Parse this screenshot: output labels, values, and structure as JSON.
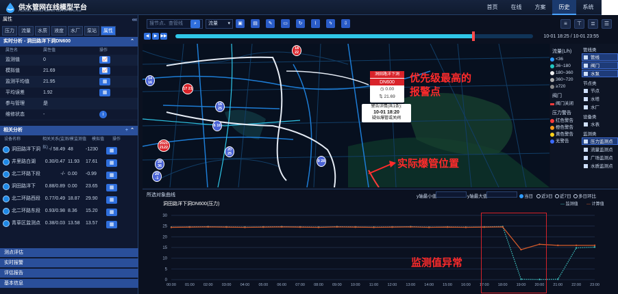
{
  "header": {
    "title": "供水管网在线模型平台",
    "subtitle": "FUZHOU ONLINE WATER SUPPLY SYSTEM",
    "nav": [
      "首页",
      "在线",
      "方案",
      "历史",
      "系统"
    ],
    "active_nav": "历史"
  },
  "left": {
    "panel_title": "属性",
    "tabs": [
      "压力",
      "流量",
      "水质",
      "液度",
      "水厂",
      "泵站",
      "属性"
    ],
    "active_tab": "属性",
    "realtime": {
      "title": "实时分析 - 洞田路洋下洞DN600",
      "columns": [
        "属性名",
        "属性值",
        "操作"
      ],
      "rows": [
        {
          "name": "监测值",
          "value": "0",
          "op": "📈"
        },
        {
          "name": "模拟值",
          "value": "21.69",
          "op": "📈"
        },
        {
          "name": "监测平均值",
          "value": "21.95",
          "op": "▦"
        },
        {
          "name": "平均误差",
          "value": "1.92",
          "op": "▦"
        },
        {
          "name": "参与管理",
          "value": "是",
          "op": ""
        },
        {
          "name": "维修状态",
          "value": "-",
          "op": "i"
        }
      ]
    },
    "correlation": {
      "title": "相关分析",
      "columns": [
        "设备名称",
        "相关关系(监测/模拟)",
        "监测值",
        "模拟值",
        "操作"
      ],
      "rows": [
        {
          "name": "洞田路洋下洞",
          "a": "-/ 58.49",
          "b": "48",
          "c": "-1230"
        },
        {
          "name": "井里路白湖",
          "a": "0.30/0.47",
          "b": "11.93",
          "c": "17.61"
        },
        {
          "name": "北二环路下段",
          "a": "-/-",
          "b": "0.00",
          "c": "-0.99"
        },
        {
          "name": "洞田路洋下",
          "a": "0.88/0.89",
          "b": "0.00",
          "c": "23.65"
        },
        {
          "name": "北二环路西段",
          "a": "0.77/0.49",
          "b": "18.87",
          "c": "29.90"
        },
        {
          "name": "北二环路东段",
          "a": "0.93/0.98",
          "b": "8.36",
          "c": "15.20"
        },
        {
          "name": "青草区监测点",
          "a": "0.38/0.03",
          "b": "13.58",
          "c": "13.57"
        }
      ]
    },
    "bottom_items": [
      "测点评估",
      "实时报警",
      "评估报告",
      "基本信息"
    ]
  },
  "toolbar": {
    "search_placeholder": "搜节点、查管线",
    "select": "流量"
  },
  "timeline": {
    "range": "10-01 18:25 / 10-01 23:55",
    "progress": 0.83
  },
  "map": {
    "popup": {
      "head": "洞田路洋下洞",
      "name": "DN600",
      "v1": "0.00",
      "v2": "21.69"
    },
    "alarm": {
      "l1": "警告详情(共1条):",
      "l2": "10-01 18:20",
      "l3": "疑似爆管或关阀"
    },
    "markers": [
      {
        "t": "18\n22"
      },
      {
        "t": "17\n21"
      },
      {
        "t": "14\n16"
      },
      {
        "t": "16\n25"
      },
      {
        "t": "6\n16"
      },
      {
        "t": "20\n25"
      },
      {
        "t": "9\n28"
      },
      {
        "t": "2021\n2122"
      },
      {
        "t": "28\n36"
      },
      {
        "t": "20\n-1"
      }
    ]
  },
  "legend": {
    "flow_title": "流量(L/h)",
    "flow": [
      {
        "label": "<36",
        "color": "#2f9bff"
      },
      {
        "label": "36~180",
        "color": "#22c7c0"
      },
      {
        "label": "180~360",
        "color": "#f0f0f0"
      },
      {
        "label": "360~720",
        "color": "#b0b0b0"
      },
      {
        "label": "≥720",
        "color": "#8a8a8a"
      }
    ],
    "valve_title": "阀门",
    "valve": [
      {
        "label": "阀门关闭",
        "color": "#ff3b3b"
      }
    ],
    "pressure_title": "压力警告",
    "pressure": [
      {
        "label": "红色警告",
        "color": "#ff3b3b"
      },
      {
        "label": "橙色警告",
        "color": "#ff9a1a"
      },
      {
        "label": "黄色警告",
        "color": "#ffd21a"
      },
      {
        "label": "无警告",
        "color": "#3b6bff"
      }
    ],
    "right": {
      "g1": "管线类",
      "b1": [
        "管线",
        "阀门",
        "水泵"
      ],
      "g2": "节点类",
      "b2": [
        "节点",
        "水塔",
        "水厂"
      ],
      "g3": "设备类",
      "b3": [
        "水表"
      ],
      "g4": "监测类",
      "b4": [
        "压力监测点",
        "流量监测点",
        "广场监测点",
        "水质监测点"
      ]
    }
  },
  "annotations": {
    "top": "优先级最高的\n报警点",
    "burst": "实际爆管位置",
    "abnormal": "监测值异常"
  },
  "chart_panel": {
    "title": "所选对象曲线",
    "subtitle": "洞田路洋下洞DN600(压力)",
    "ymin_label": "y轴最小值",
    "ymax_label": "y轴最大值",
    "radios": [
      "当日",
      "近3日",
      "近7日",
      "多日环比"
    ],
    "legend": [
      "监测值",
      "计算值"
    ]
  },
  "chart_data": {
    "type": "line",
    "title": "洞田路洋下洞DN600(压力)",
    "x": [
      "00:00",
      "01:00",
      "02:00",
      "03:00",
      "04:00",
      "05:00",
      "06:00",
      "07:00",
      "08:00",
      "09:00",
      "10:00",
      "11:00",
      "12:00",
      "13:00",
      "14:00",
      "15:00",
      "16:00",
      "17:00",
      "18:00",
      "19:00",
      "20:00",
      "21:00",
      "22:00",
      "23:00"
    ],
    "ylim": [
      0,
      30
    ],
    "yticks": [
      0,
      5,
      10,
      15,
      20,
      25,
      30
    ],
    "series": [
      {
        "name": "监测值",
        "color": "#3fc1c0",
        "values": [
          24.5,
          24.6,
          24.7,
          24.6,
          24.5,
          24.6,
          24.7,
          24.6,
          24.5,
          24.7,
          24.6,
          24.5,
          24.6,
          24.7,
          24.5,
          24.6,
          24.5,
          24.6,
          24.8,
          0.2,
          0.1,
          0.2,
          14.8,
          15.2
        ]
      },
      {
        "name": "计算值",
        "color": "#d35a2a",
        "values": [
          24.4,
          24.5,
          24.6,
          24.5,
          24.4,
          24.5,
          24.6,
          24.5,
          24.4,
          24.6,
          24.5,
          24.4,
          24.5,
          24.6,
          24.4,
          24.5,
          24.4,
          24.5,
          24.6,
          14.0,
          16.5,
          16.0,
          16.0,
          16.0
        ]
      }
    ]
  }
}
